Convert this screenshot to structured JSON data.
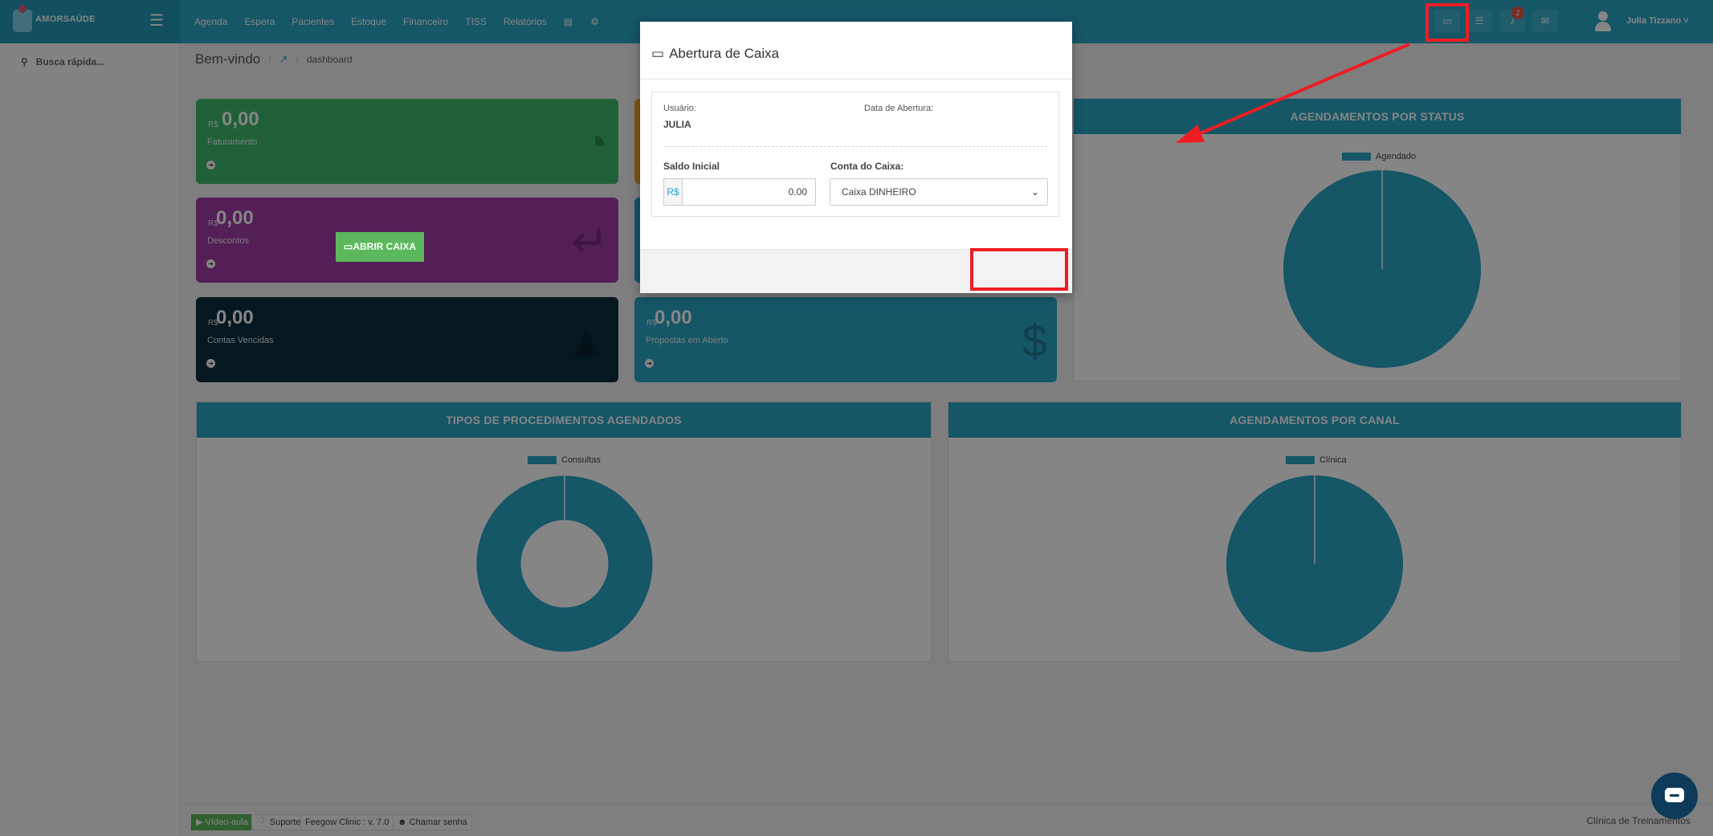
{
  "brand": {
    "logo_text": "AMORSAÚDE"
  },
  "nav": {
    "items": [
      "Agenda",
      "Espera",
      "Pacientes",
      "Estoque",
      "Financeiro",
      "TISS",
      "Relatórios"
    ],
    "icons": [
      "database-icon",
      "gear-icon"
    ]
  },
  "topbar": {
    "notifications_count": "2",
    "user_name": "Julia Tizzano"
  },
  "sidebar": {
    "search_placeholder": "Busca rápida..."
  },
  "breadcrumb": {
    "title": "Bem-vindo",
    "current": "dashboard"
  },
  "tiles": [
    {
      "currency": "R$",
      "value": "0,00",
      "label": "Faturamento"
    },
    {
      "currency": "R$",
      "value": "0,00",
      "label": "Descontos"
    },
    {
      "currency": "R$",
      "value": "0,00",
      "label": "Contas Vencidas"
    },
    {
      "currency": "R$",
      "value": "0,00",
      "label": "Propostas em Aberto"
    }
  ],
  "panels": {
    "status": {
      "title": "AGENDAMENTOS POR STATUS",
      "legend": "Agendado"
    },
    "tipos": {
      "title": "TIPOS DE PROCEDIMENTOS AGENDADOS",
      "legend": "Consultas"
    },
    "canal": {
      "title": "AGENDAMENTOS POR CANAL",
      "legend": "Clínica"
    }
  },
  "chart_data": [
    {
      "type": "pie",
      "title": "AGENDAMENTOS POR STATUS",
      "categories": [
        "Agendado"
      ],
      "values": [
        100
      ],
      "legend_position": "top"
    },
    {
      "type": "pie",
      "title": "TIPOS DE PROCEDIMENTOS AGENDADOS",
      "categories": [
        "Consultas"
      ],
      "values": [
        100
      ],
      "donut": true,
      "legend_position": "top"
    },
    {
      "type": "pie",
      "title": "AGENDAMENTOS POR CANAL",
      "categories": [
        "Clínica"
      ],
      "values": [
        100
      ],
      "legend_position": "top"
    }
  ],
  "modal": {
    "title": "Abertura de Caixa",
    "user_label": "Usuário:",
    "user_value": "JULIA",
    "date_label": "Data de Abertura:",
    "saldo_label": "Saldo Inicial",
    "currency": "R$",
    "saldo_value": "0.00",
    "conta_label": "Conta do Caixa:",
    "conta_value": "Caixa DINHEIRO",
    "open_button": "ABRIR CAIXA"
  },
  "footer": {
    "video": "Vídeo-aula",
    "suporte": "Suporte",
    "version": "Feegow Clinic : v. 7.0",
    "chamar": "Chamar senha",
    "clinic": "Clínica de Treinamentos"
  },
  "colors": {
    "primary": "#2aa5c6",
    "success": "#5cb85c",
    "annotation": "#ee1d23"
  }
}
